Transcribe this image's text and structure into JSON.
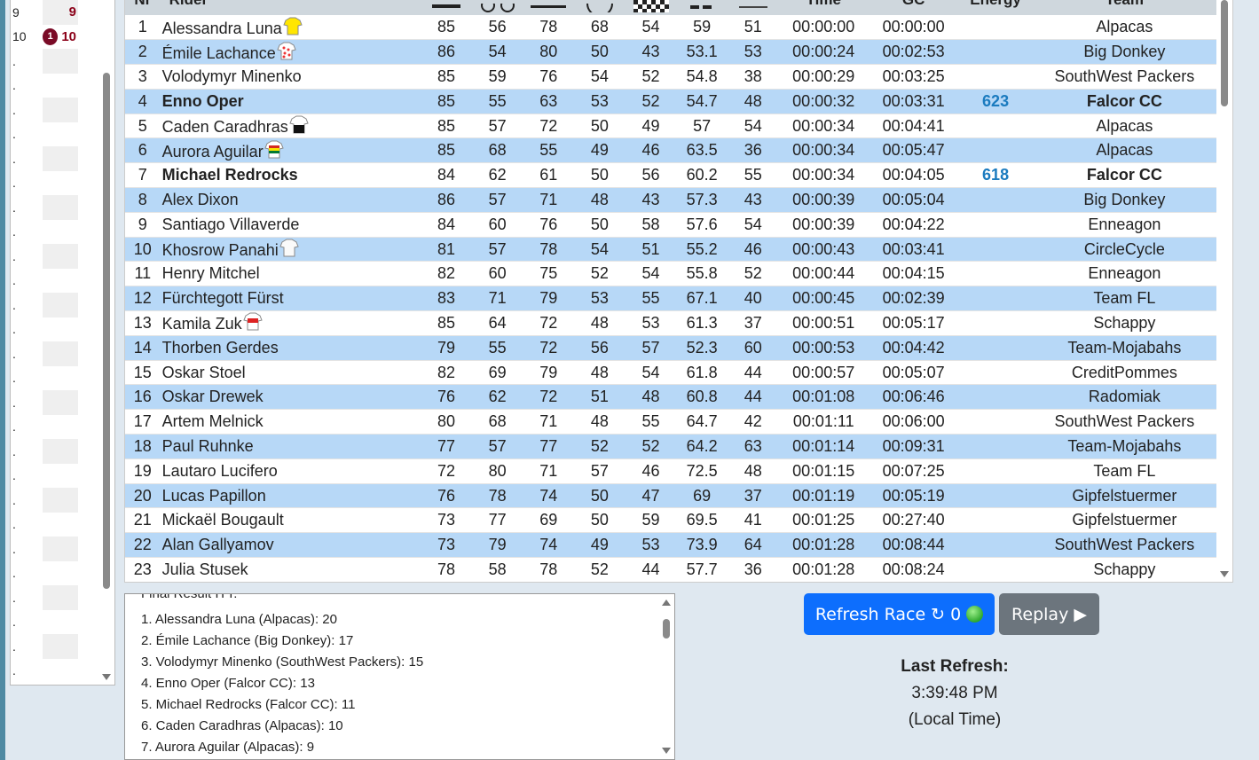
{
  "left_panel": {
    "rows": [
      {
        "c1": "9",
        "c2_badge": "",
        "c2_num": "9"
      },
      {
        "c1": "10",
        "c2_badge": "1",
        "c2_num": "10"
      },
      {
        "c1": ".",
        "c2_badge": "",
        "c2_num": ""
      },
      {
        "c1": ".",
        "c2_badge": "",
        "c2_num": ""
      },
      {
        "c1": ".",
        "c2_badge": "",
        "c2_num": ""
      },
      {
        "c1": ".",
        "c2_badge": "",
        "c2_num": ""
      },
      {
        "c1": ".",
        "c2_badge": "",
        "c2_num": ""
      },
      {
        "c1": ".",
        "c2_badge": "",
        "c2_num": ""
      },
      {
        "c1": ".",
        "c2_badge": "",
        "c2_num": ""
      },
      {
        "c1": ".",
        "c2_badge": "",
        "c2_num": ""
      },
      {
        "c1": ".",
        "c2_badge": "",
        "c2_num": ""
      },
      {
        "c1": ".",
        "c2_badge": "",
        "c2_num": ""
      },
      {
        "c1": ".",
        "c2_badge": "",
        "c2_num": ""
      },
      {
        "c1": ".",
        "c2_badge": "",
        "c2_num": ""
      },
      {
        "c1": ".",
        "c2_badge": "",
        "c2_num": ""
      },
      {
        "c1": ".",
        "c2_badge": "",
        "c2_num": ""
      },
      {
        "c1": ".",
        "c2_badge": "",
        "c2_num": ""
      },
      {
        "c1": ".",
        "c2_badge": "",
        "c2_num": ""
      },
      {
        "c1": ".",
        "c2_badge": "",
        "c2_num": ""
      },
      {
        "c1": ".",
        "c2_badge": "",
        "c2_num": ""
      },
      {
        "c1": ".",
        "c2_badge": "",
        "c2_num": ""
      },
      {
        "c1": ".",
        "c2_badge": "",
        "c2_num": ""
      },
      {
        "c1": ".",
        "c2_badge": "",
        "c2_num": ""
      },
      {
        "c1": ".",
        "c2_badge": "",
        "c2_num": ""
      },
      {
        "c1": ".",
        "c2_badge": "",
        "c2_num": ""
      },
      {
        "c1": ".",
        "c2_badge": "",
        "c2_num": ""
      },
      {
        "c1": ".",
        "c2_badge": "",
        "c2_num": ""
      },
      {
        "c1": ".",
        "c2_badge": "",
        "c2_num": ""
      }
    ]
  },
  "table": {
    "headers": {
      "nr": "Nr",
      "rider": "Rider",
      "time": "Time",
      "gc": "GC",
      "energy": "Energy",
      "team": "Team"
    },
    "header_icons": [
      "flat-icon",
      "bike-icon",
      "hill-icon",
      "circle-icon",
      "checkered-flag-icon",
      "sprint-icon",
      "mountain-icon"
    ],
    "rows": [
      {
        "nr": "1",
        "rider": "Alessandra Luna",
        "jersey": "yellow",
        "bold": false,
        "v1": "85",
        "v2": "56",
        "v3": "78",
        "v4": "68",
        "v5": "54",
        "v6": "59",
        "v7": "51",
        "time": "00:00:00",
        "gc": "00:00:00",
        "energy": "",
        "team": "Alpacas"
      },
      {
        "nr": "2",
        "rider": "Émile Lachance",
        "jersey": "polka",
        "bold": false,
        "v1": "86",
        "v2": "54",
        "v3": "80",
        "v4": "50",
        "v5": "43",
        "v6": "53.1",
        "v7": "53",
        "time": "00:00:24",
        "gc": "00:02:53",
        "energy": "",
        "team": "Big Donkey"
      },
      {
        "nr": "3",
        "rider": "Volodymyr Minenko",
        "jersey": "",
        "bold": false,
        "v1": "85",
        "v2": "59",
        "v3": "76",
        "v4": "54",
        "v5": "52",
        "v6": "54.8",
        "v7": "38",
        "time": "00:00:29",
        "gc": "00:03:25",
        "energy": "",
        "team": "SouthWest Packers"
      },
      {
        "nr": "4",
        "rider": "Enno Oper",
        "jersey": "",
        "bold": true,
        "v1": "85",
        "v2": "55",
        "v3": "63",
        "v4": "53",
        "v5": "52",
        "v6": "54.7",
        "v7": "48",
        "time": "00:00:32",
        "gc": "00:03:31",
        "energy": "623",
        "team": "Falcor CC"
      },
      {
        "nr": "5",
        "rider": "Caden Caradhras",
        "jersey": "black-white",
        "bold": false,
        "v1": "85",
        "v2": "57",
        "v3": "72",
        "v4": "50",
        "v5": "49",
        "v6": "57",
        "v7": "54",
        "time": "00:00:34",
        "gc": "00:04:41",
        "energy": "",
        "team": "Alpacas"
      },
      {
        "nr": "6",
        "rider": "Aurora Aguilar",
        "jersey": "bolivia",
        "bold": false,
        "v1": "85",
        "v2": "68",
        "v3": "55",
        "v4": "49",
        "v5": "46",
        "v6": "63.5",
        "v7": "36",
        "time": "00:00:34",
        "gc": "00:05:47",
        "energy": "",
        "team": "Alpacas"
      },
      {
        "nr": "7",
        "rider": "Michael Redrocks",
        "jersey": "",
        "bold": true,
        "v1": "84",
        "v2": "62",
        "v3": "61",
        "v4": "50",
        "v5": "56",
        "v6": "60.2",
        "v7": "55",
        "time": "00:00:34",
        "gc": "00:04:05",
        "energy": "618",
        "team": "Falcor CC"
      },
      {
        "nr": "8",
        "rider": "Alex Dixon",
        "jersey": "",
        "bold": false,
        "v1": "86",
        "v2": "57",
        "v3": "71",
        "v4": "48",
        "v5": "43",
        "v6": "57.3",
        "v7": "43",
        "time": "00:00:39",
        "gc": "00:05:04",
        "energy": "",
        "team": "Big Donkey"
      },
      {
        "nr": "9",
        "rider": "Santiago Villaverde",
        "jersey": "",
        "bold": false,
        "v1": "84",
        "v2": "60",
        "v3": "76",
        "v4": "50",
        "v5": "58",
        "v6": "57.6",
        "v7": "54",
        "time": "00:00:39",
        "gc": "00:04:22",
        "energy": "",
        "team": "Enneagon"
      },
      {
        "nr": "10",
        "rider": "Khosrow Panahi",
        "jersey": "white",
        "bold": false,
        "v1": "81",
        "v2": "57",
        "v3": "78",
        "v4": "54",
        "v5": "51",
        "v6": "55.2",
        "v7": "46",
        "time": "00:00:43",
        "gc": "00:03:41",
        "energy": "",
        "team": "CircleCycle"
      },
      {
        "nr": "11",
        "rider": "Henry Mitchel",
        "jersey": "",
        "bold": false,
        "v1": "82",
        "v2": "60",
        "v3": "75",
        "v4": "52",
        "v5": "54",
        "v6": "55.8",
        "v7": "52",
        "time": "00:00:44",
        "gc": "00:04:15",
        "energy": "",
        "team": "Enneagon"
      },
      {
        "nr": "12",
        "rider": "Fürchtegott Fürst",
        "jersey": "",
        "bold": false,
        "v1": "83",
        "v2": "71",
        "v3": "79",
        "v4": "53",
        "v5": "55",
        "v6": "67.1",
        "v7": "40",
        "time": "00:00:45",
        "gc": "00:02:39",
        "energy": "",
        "team": "Team FL"
      },
      {
        "nr": "13",
        "rider": "Kamila Zuk",
        "jersey": "red-white",
        "bold": false,
        "v1": "85",
        "v2": "64",
        "v3": "72",
        "v4": "48",
        "v5": "53",
        "v6": "61.3",
        "v7": "37",
        "time": "00:00:51",
        "gc": "00:05:17",
        "energy": "",
        "team": "Schappy"
      },
      {
        "nr": "14",
        "rider": "Thorben Gerdes",
        "jersey": "",
        "bold": false,
        "v1": "79",
        "v2": "55",
        "v3": "72",
        "v4": "56",
        "v5": "57",
        "v6": "52.3",
        "v7": "60",
        "time": "00:00:53",
        "gc": "00:04:42",
        "energy": "",
        "team": "Team-Mojabahs"
      },
      {
        "nr": "15",
        "rider": "Oskar Stoel",
        "jersey": "",
        "bold": false,
        "v1": "82",
        "v2": "69",
        "v3": "79",
        "v4": "48",
        "v5": "54",
        "v6": "61.8",
        "v7": "44",
        "time": "00:00:57",
        "gc": "00:05:07",
        "energy": "",
        "team": "CreditPommes"
      },
      {
        "nr": "16",
        "rider": "Oskar Drewek",
        "jersey": "",
        "bold": false,
        "v1": "76",
        "v2": "62",
        "v3": "72",
        "v4": "51",
        "v5": "48",
        "v6": "60.8",
        "v7": "44",
        "time": "00:01:08",
        "gc": "00:06:46",
        "energy": "",
        "team": "Radomiak"
      },
      {
        "nr": "17",
        "rider": "Artem Melnick",
        "jersey": "",
        "bold": false,
        "v1": "80",
        "v2": "68",
        "v3": "71",
        "v4": "48",
        "v5": "55",
        "v6": "64.7",
        "v7": "42",
        "time": "00:01:11",
        "gc": "00:06:00",
        "energy": "",
        "team": "SouthWest Packers"
      },
      {
        "nr": "18",
        "rider": "Paul Ruhnke",
        "jersey": "",
        "bold": false,
        "v1": "77",
        "v2": "57",
        "v3": "77",
        "v4": "52",
        "v5": "52",
        "v6": "64.2",
        "v7": "63",
        "time": "00:01:14",
        "gc": "00:09:31",
        "energy": "",
        "team": "Team-Mojabahs"
      },
      {
        "nr": "19",
        "rider": "Lautaro Lucifero",
        "jersey": "",
        "bold": false,
        "v1": "72",
        "v2": "80",
        "v3": "71",
        "v4": "57",
        "v5": "46",
        "v6": "72.5",
        "v7": "48",
        "time": "00:01:15",
        "gc": "00:07:25",
        "energy": "",
        "team": "Team FL"
      },
      {
        "nr": "20",
        "rider": "Lucas Papillon",
        "jersey": "",
        "bold": false,
        "v1": "76",
        "v2": "78",
        "v3": "74",
        "v4": "50",
        "v5": "47",
        "v6": "69",
        "v7": "37",
        "time": "00:01:19",
        "gc": "00:05:19",
        "energy": "",
        "team": "Gipfelstuermer"
      },
      {
        "nr": "21",
        "rider": "Mickaël Bougault",
        "jersey": "",
        "bold": false,
        "v1": "73",
        "v2": "77",
        "v3": "69",
        "v4": "50",
        "v5": "59",
        "v6": "69.5",
        "v7": "41",
        "time": "00:01:25",
        "gc": "00:27:40",
        "energy": "",
        "team": "Gipfelstuermer"
      },
      {
        "nr": "22",
        "rider": "Alan Gallyamov",
        "jersey": "",
        "bold": false,
        "v1": "73",
        "v2": "79",
        "v3": "74",
        "v4": "49",
        "v5": "53",
        "v6": "73.9",
        "v7": "64",
        "time": "00:01:28",
        "gc": "00:08:44",
        "energy": "",
        "team": "SouthWest Packers"
      },
      {
        "nr": "23",
        "rider": "Julia Stusek",
        "jersey": "",
        "bold": false,
        "v1": "78",
        "v2": "58",
        "v3": "78",
        "v4": "52",
        "v5": "44",
        "v6": "57.7",
        "v7": "36",
        "time": "00:01:28",
        "gc": "00:08:24",
        "energy": "",
        "team": "Schappy"
      }
    ]
  },
  "log": {
    "title": "Final Result ITT:",
    "lines": [
      "1. Alessandra Luna (Alpacas): 20",
      "2. Émile Lachance (Big Donkey): 17",
      "3. Volodymyr Minenko (SouthWest Packers): 15",
      "4. Enno Oper (Falcor CC): 13",
      "5. Michael Redrocks (Falcor CC): 11",
      "6. Caden Caradhras (Alpacas): 10",
      "7. Aurora Aguilar (Alpacas): 9"
    ]
  },
  "buttons": {
    "refresh_label": "Refresh Race",
    "refresh_icon": "↻",
    "refresh_count": "0",
    "replay_label": "Replay",
    "replay_icon": "▶"
  },
  "refresh_info": {
    "label": "Last Refresh:",
    "time": "3:39:48 PM",
    "note": "(Local Time)"
  },
  "colors": {
    "row_alt": "#b7d8f7",
    "energy": "#1b7bbf",
    "refresh_button": "#0d6efd",
    "replay_button": "#6c757d",
    "badge": "#7a0b27"
  }
}
